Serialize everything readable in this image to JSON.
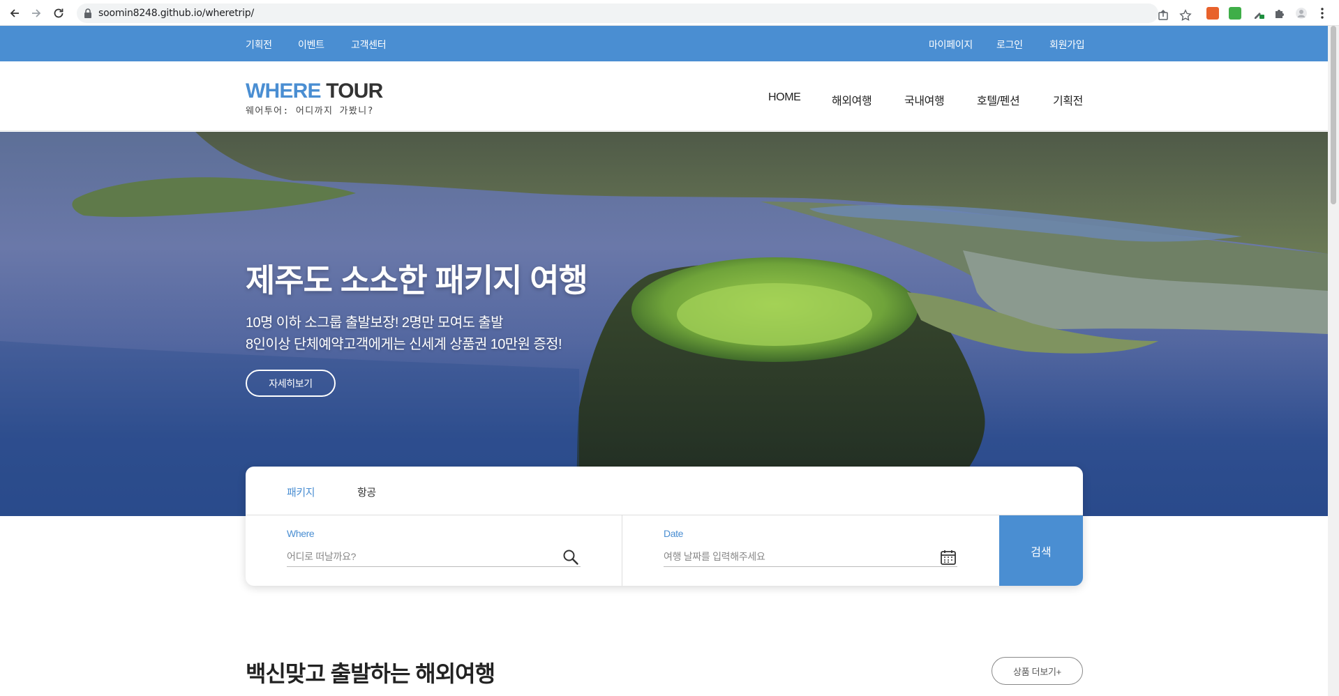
{
  "browser": {
    "url": "soomin8248.github.io/wheretrip/"
  },
  "topbar": {
    "left_links": [
      "기획전",
      "이벤트",
      "고객센터"
    ],
    "right_links": [
      "마이페이지",
      "로그인",
      "회원가입"
    ]
  },
  "logo": {
    "word1": "WHERE",
    "word2": "TOUR",
    "tagline": "웨어투어: 어디까지 가봤니?"
  },
  "gnb": [
    "HOME",
    "해외여행",
    "국내여행",
    "호텔/펜션",
    "기획전"
  ],
  "hero": {
    "title": "제주도 소소한 패키지 여행",
    "sub_line1": "10명 이하 소그룹 출발보장! 2명만 모여도 출발",
    "sub_line2": "8인이상 단체예약고객에게는 신세계 상품권 10만원 증정!",
    "button": "자세히보기"
  },
  "search": {
    "tabs": [
      "패키지",
      "항공"
    ],
    "where_label": "Where",
    "where_placeholder": "어디로 떠날까요?",
    "date_label": "Date",
    "date_placeholder": "여행 날짜를 입력해주세요",
    "button": "검색"
  },
  "section": {
    "title": "백신맞고 출발하는 해외여행",
    "more_button": "상품 더보기+"
  },
  "colors": {
    "brand_blue": "#4a8ed2",
    "text_dark": "#222222"
  }
}
